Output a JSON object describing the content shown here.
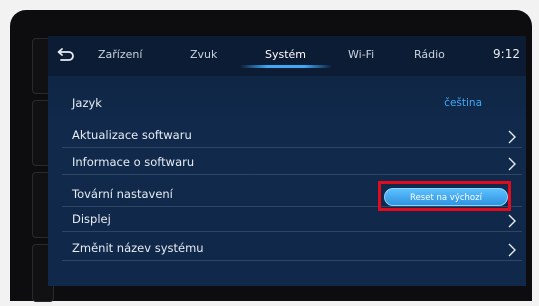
{
  "header": {
    "tabs": [
      {
        "label": "Zařízení"
      },
      {
        "label": "Zvuk"
      },
      {
        "label": "Systém"
      },
      {
        "label": "Wi-Fi"
      },
      {
        "label": "Rádio"
      }
    ],
    "active_tab": "Systém",
    "clock": "9:12",
    "back_icon": "back-arrow-icon"
  },
  "settings": {
    "rows": [
      {
        "label": "Jazyk",
        "value": "čeština"
      },
      {
        "label": "Aktualizace softwaru"
      },
      {
        "label": "Informace o softwaru"
      },
      {
        "label": "Tovární nastavení",
        "button_label": "Reset na výchozí"
      },
      {
        "label": "Displej"
      },
      {
        "label": "Změnit název systému"
      }
    ]
  },
  "colors": {
    "accent": "#3fa9f5",
    "highlight_box": "#e10b1d",
    "screen_bg": "#10284a"
  }
}
